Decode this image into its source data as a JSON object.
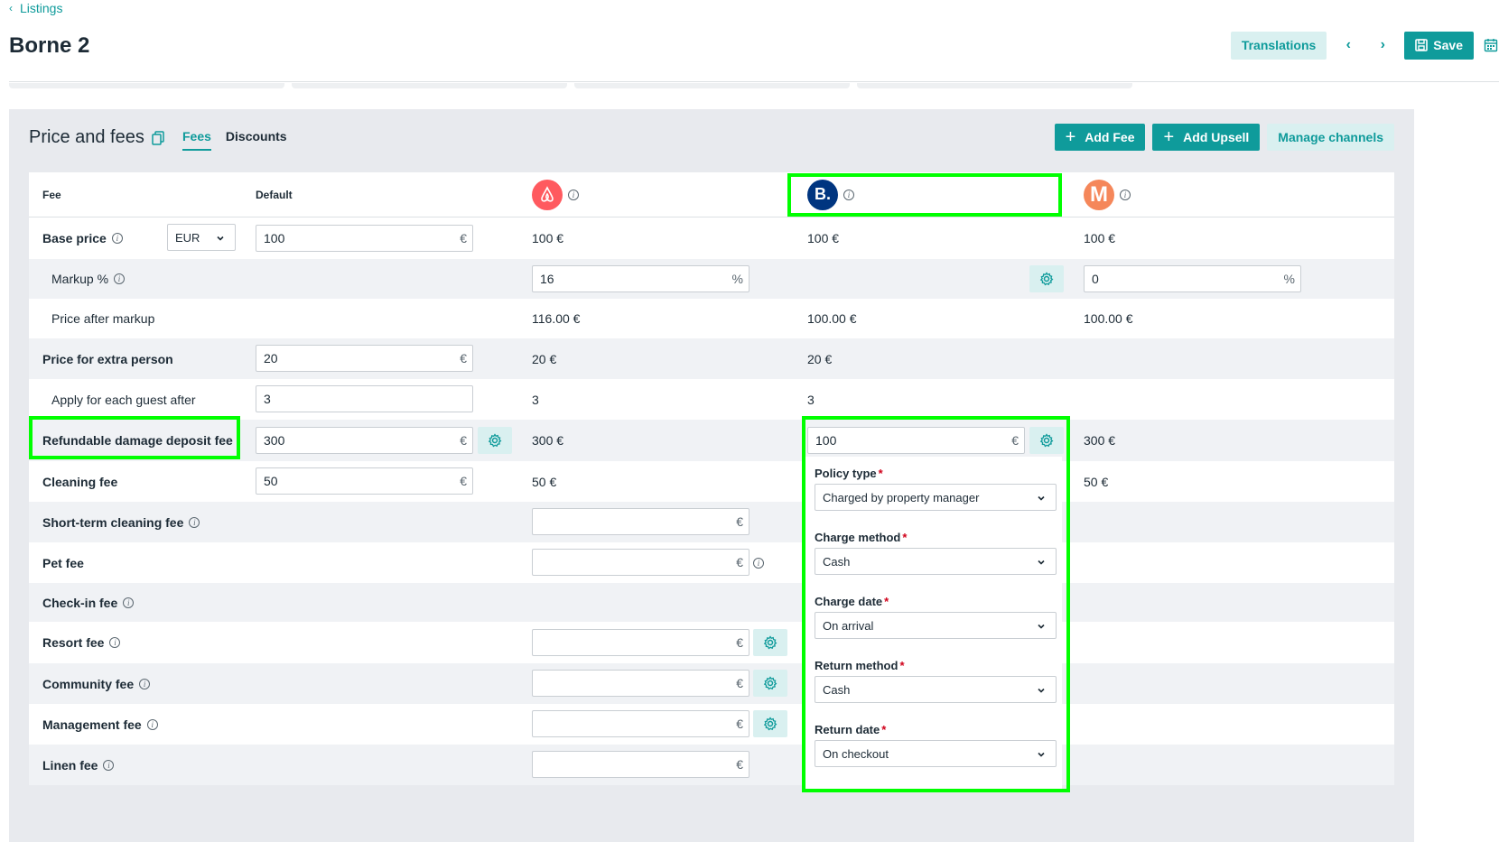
{
  "header": {
    "back_label": "Listings",
    "title": "Borne 2",
    "translations_label": "Translations",
    "save_label": "Save"
  },
  "panel": {
    "title": "Price and fees",
    "tabs": [
      "Fees",
      "Discounts"
    ],
    "add_fee_label": "Add Fee",
    "add_upsell_label": "Add Upsell",
    "manage_channels_label": "Manage channels"
  },
  "table": {
    "col_fee": "Fee",
    "col_default": "Default",
    "channels": [
      {
        "name": "Airbnb",
        "icon": "airbnb-logo-icon",
        "color": "#ff5a5f"
      },
      {
        "name": "Booking.com",
        "letter": "B.",
        "icon": "booking-logo-icon",
        "color": "#003580"
      },
      {
        "name": "M",
        "letter": "M",
        "icon": "m-channel-logo-icon",
        "color": "#f5875a"
      }
    ],
    "rows": {
      "base_price": {
        "label": "Base price",
        "currency": "EUR",
        "default": "100",
        "airbnb": "100 €",
        "booking": "100 €",
        "m": "100 €"
      },
      "markup": {
        "label": "Markup %",
        "airbnb": "16",
        "m": "0"
      },
      "price_after_markup": {
        "label": "Price after markup",
        "airbnb": "116.00 €",
        "booking": "100.00 €",
        "m": "100.00 €"
      },
      "extra_person": {
        "label": "Price for extra person",
        "default": "20",
        "airbnb": "20 €",
        "booking": "20 €"
      },
      "apply_after": {
        "label": "Apply for each guest after",
        "default": "3",
        "airbnb": "3",
        "booking": "3"
      },
      "deposit": {
        "label": "Refundable damage deposit fee",
        "default": "300",
        "airbnb": "300 €",
        "booking": "100",
        "m": "300 €"
      },
      "cleaning": {
        "label": "Cleaning fee",
        "default": "50",
        "airbnb": "50 €",
        "m": "50 €"
      },
      "short_cleaning": {
        "label": "Short-term cleaning fee"
      },
      "pet": {
        "label": "Pet fee"
      },
      "checkin": {
        "label": "Check-in fee"
      },
      "resort": {
        "label": "Resort fee"
      },
      "community": {
        "label": "Community fee"
      },
      "management": {
        "label": "Management fee"
      },
      "linen": {
        "label": "Linen fee"
      }
    },
    "units": {
      "euro": "€",
      "percent": "%"
    }
  },
  "deposit_popover": {
    "policy_type_label": "Policy type",
    "policy_type_value": "Charged by property manager",
    "charge_method_label": "Charge method",
    "charge_method_value": "Cash",
    "charge_date_label": "Charge date",
    "charge_date_value": "On arrival",
    "return_method_label": "Return method",
    "return_method_value": "Cash",
    "return_date_label": "Return date",
    "return_date_value": "On checkout",
    "required_mark": "*"
  },
  "colors": {
    "accent": "#0f9b9b",
    "accent_light": "#d9f0f0",
    "highlight": "#00ff00",
    "required": "#d0021b"
  }
}
